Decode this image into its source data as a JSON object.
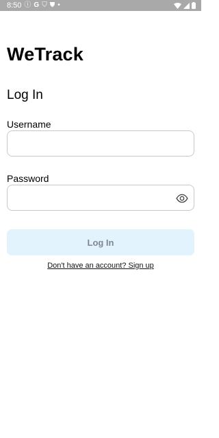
{
  "status_bar": {
    "time": "8:50"
  },
  "app": {
    "title": "WeTrack"
  },
  "screen": {
    "title": "Log In"
  },
  "form": {
    "username_label": "Username",
    "username_value": "",
    "password_label": "Password",
    "password_value": ""
  },
  "actions": {
    "login_label": "Log In",
    "signup_link": "Don't have an account? Sign up"
  },
  "colors": {
    "status_bar_bg": "#a9a9a9",
    "button_bg": "#e3f3fd",
    "button_text": "#7f8890",
    "field_border": "#c8c8c8"
  }
}
